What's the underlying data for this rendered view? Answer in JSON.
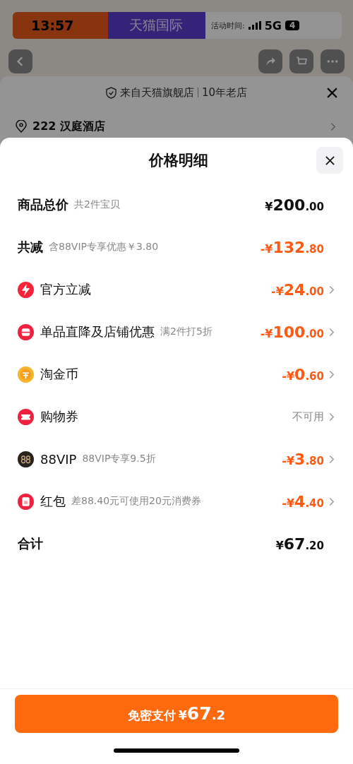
{
  "status_bar": {
    "time": "13:57",
    "network": "5G",
    "battery": "4"
  },
  "background": {
    "banner": {
      "brand": "天猫国际",
      "activity": "活动时间:"
    },
    "store_notice": {
      "source": "来自天猫旗舰店",
      "age": "10年老店"
    },
    "address": "222 汉庭酒店"
  },
  "sheet": {
    "title": "价格明细",
    "rows": [
      {
        "kind": "summary",
        "label": "商品总价",
        "note": "共2件宝贝",
        "value": {
          "sign": "¥",
          "int": "200",
          "dec": ".00",
          "negative": false
        },
        "link": false
      },
      {
        "kind": "summary",
        "label": "共减",
        "note": "含88VIP专享优惠￥3.80",
        "value": {
          "sign": "-¥",
          "int": "132",
          "dec": ".80",
          "negative": true
        },
        "link": false
      },
      {
        "kind": "discount",
        "label": "官方立减",
        "value": {
          "sign": "-¥",
          "int": "24",
          "dec": ".00",
          "negative": true
        },
        "link": true
      },
      {
        "kind": "discount",
        "label": "单品直降及店铺优惠",
        "note": "满2件打5折",
        "value": {
          "sign": "-¥",
          "int": "100",
          "dec": ".00",
          "negative": true
        },
        "link": true
      },
      {
        "kind": "discount",
        "label": "淘金币",
        "value": {
          "sign": "-¥",
          "int": "0",
          "dec": ".60",
          "negative": true
        },
        "link": true
      },
      {
        "kind": "discount",
        "label": "购物券",
        "value": {
          "text": "不可用"
        },
        "link": true
      },
      {
        "kind": "discount",
        "label": "88VIP",
        "note": "88VIP专享9.5折",
        "value": {
          "sign": "-¥",
          "int": "3",
          "dec": ".80",
          "negative": true
        },
        "link": true
      },
      {
        "kind": "discount",
        "label": "红包",
        "note": "差88.40元可使用20元消费券",
        "value": {
          "sign": "-¥",
          "int": "4",
          "dec": ".40",
          "negative": true
        },
        "link": true
      },
      {
        "kind": "summary",
        "label": "合计",
        "value": {
          "sign": "¥",
          "int": "67",
          "dec": ".20",
          "negative": false
        },
        "link": false
      }
    ],
    "pay_button": {
      "label": "免密支付",
      "sign": "¥",
      "int": "67",
      "dec": ".2"
    }
  }
}
